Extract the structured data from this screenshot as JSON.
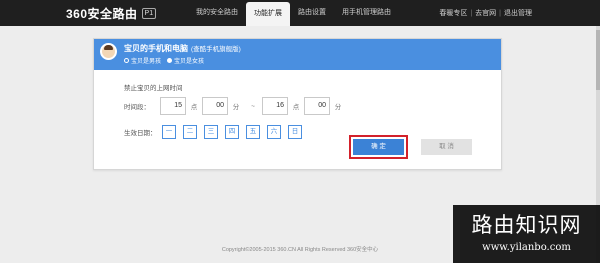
{
  "header": {
    "brand": "360安全路由",
    "brand_badge": "P1",
    "nav": [
      {
        "label": "我的安全路由"
      },
      {
        "label": "功能扩展"
      },
      {
        "label": "路由设置"
      },
      {
        "label": "用手机管理路由"
      }
    ],
    "active_nav": "功能扩展",
    "links": [
      "春暖专区",
      "去官网",
      "退出管理"
    ]
  },
  "card": {
    "title": "宝贝的手机和电脑",
    "title_sub": "(查酷手机旗舰版)",
    "radio_boy": "宝贝是男孩",
    "radio_girl": "宝贝是女孩",
    "selected_gender": "宝贝是女孩",
    "section_label": "禁止宝贝的上网时间",
    "time_label": "时间段：",
    "start_hour": "15",
    "start_minute": "00",
    "end_hour": "16",
    "end_minute": "00",
    "unit_hour": "点",
    "unit_minute": "分",
    "separator": "~",
    "days_label": "生效日期：",
    "days": [
      "一",
      "二",
      "三",
      "四",
      "五",
      "六",
      "日"
    ],
    "ok": "确 定",
    "cancel": "取 消"
  },
  "footer": "Copyright©2005-2015 360.CN All Rights Reserved 360安全中心",
  "watermark": {
    "title": "路由知识网",
    "url": "www.yilanbo.com"
  },
  "colors": {
    "accent": "#4a8fe0",
    "topbar": "#1f1f1f",
    "highlight": "#d3212b"
  }
}
